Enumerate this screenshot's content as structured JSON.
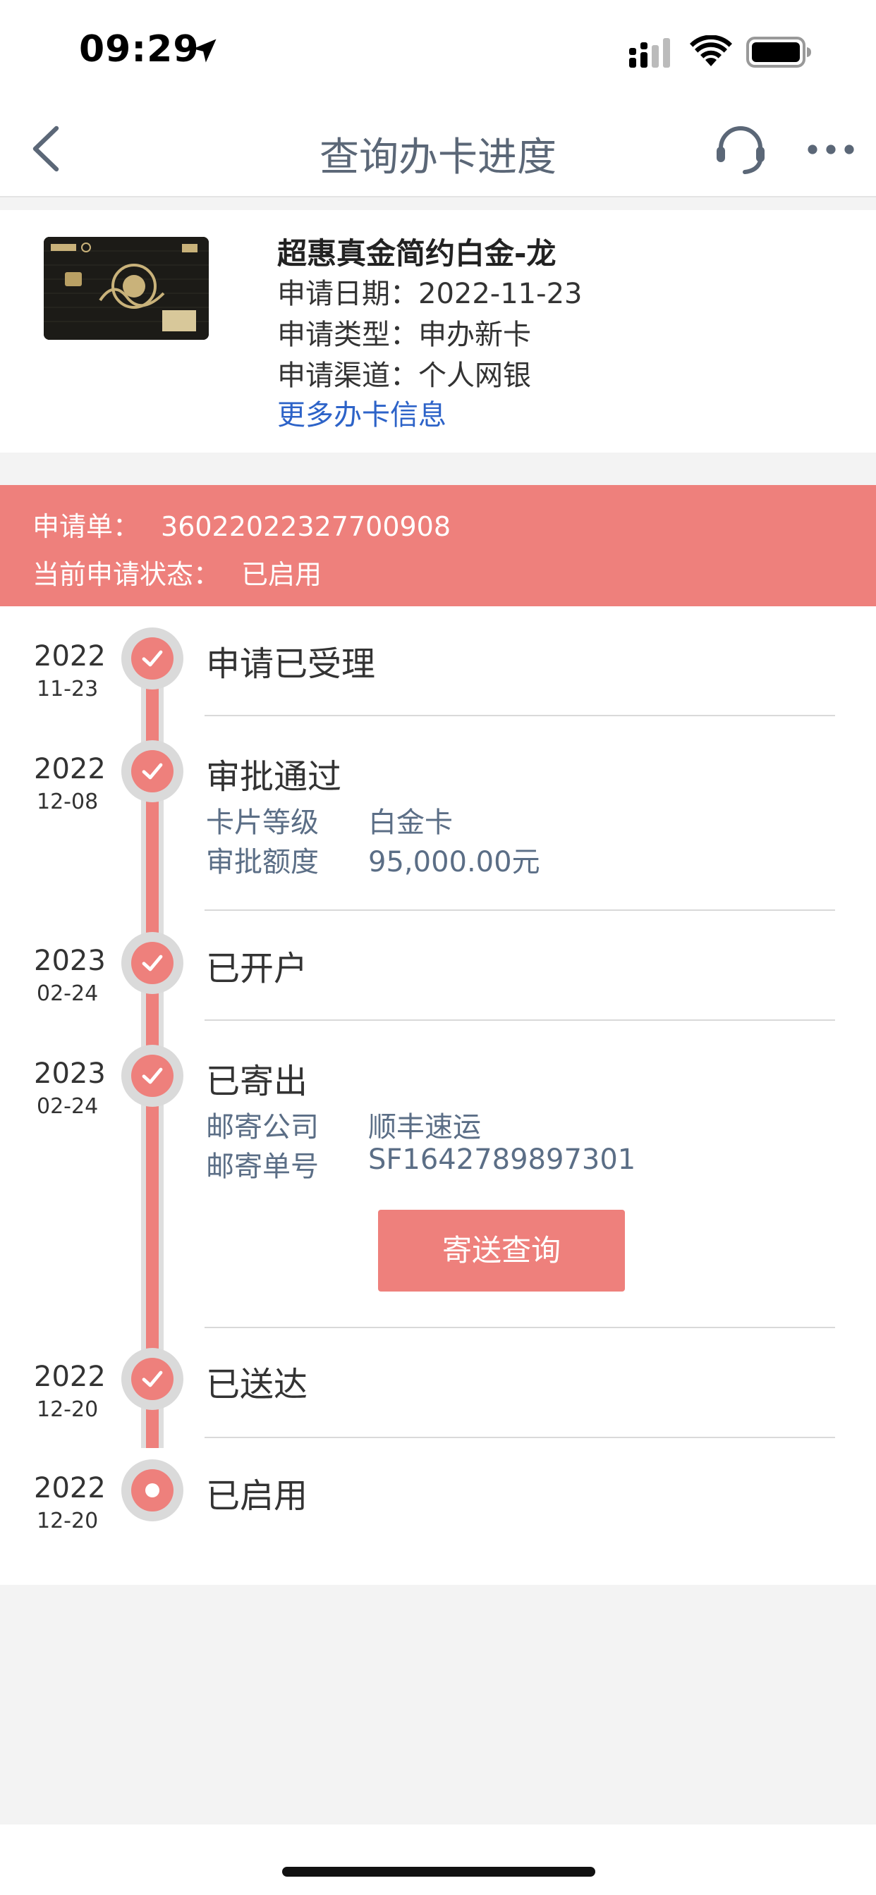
{
  "status_bar": {
    "time": "09:29"
  },
  "nav": {
    "title": "查询办卡进度"
  },
  "card": {
    "name": "超惠真金简约白金-龙",
    "lines": [
      {
        "label": "申请日期：",
        "value": "2022-11-23"
      },
      {
        "label": "申请类型：",
        "value": "申办新卡"
      },
      {
        "label": "申请渠道：",
        "value": "个人网银"
      }
    ],
    "more_link": "更多办卡信息"
  },
  "banner": {
    "order_label": "申请单：",
    "order_value": "36022022327700908",
    "status_label": "当前申请状态：",
    "status_value": "已启用"
  },
  "colors": {
    "accent": "#ee807c",
    "link": "#2d63c8",
    "detail": "#5b6e86"
  },
  "timeline": [
    {
      "year": "2022",
      "md": "11-23",
      "title": "申请已受理",
      "icon": "check-icon",
      "details": []
    },
    {
      "year": "2022",
      "md": "12-08",
      "title": "审批通过",
      "icon": "check-icon",
      "details": [
        {
          "label": "卡片等级",
          "value": "白金卡"
        },
        {
          "label": "审批额度",
          "value": "95,000.00元"
        }
      ]
    },
    {
      "year": "2023",
      "md": "02-24",
      "title": "已开户",
      "icon": "check-icon",
      "details": []
    },
    {
      "year": "2023",
      "md": "02-24",
      "title": "已寄出",
      "icon": "check-icon",
      "details": [
        {
          "label": "邮寄公司",
          "value": "顺丰速运"
        },
        {
          "label": "邮寄单号",
          "value": "SF1642789897301"
        }
      ],
      "button": "寄送查询"
    },
    {
      "year": "2022",
      "md": "12-20",
      "title": "已送达",
      "icon": "check-icon",
      "details": []
    },
    {
      "year": "2022",
      "md": "12-20",
      "title": "已启用",
      "icon": "current-dot-icon",
      "details": []
    }
  ]
}
